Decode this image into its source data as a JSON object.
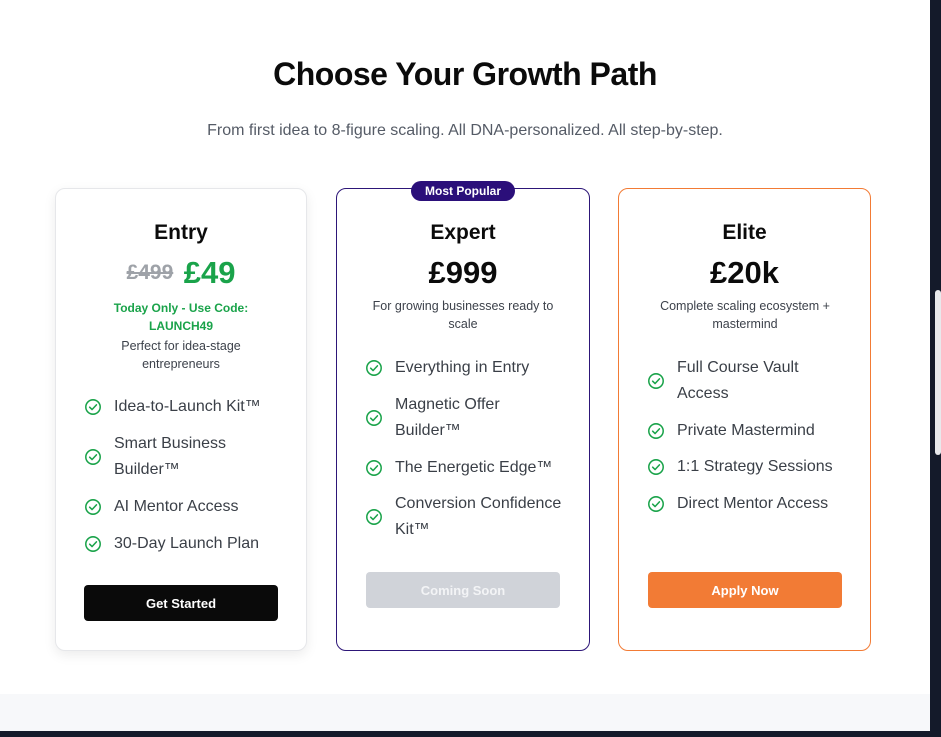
{
  "section": {
    "title": "Choose Your Growth Path",
    "subtitle": "From first idea to 8-figure scaling. All DNA-personalized. All step-by-step."
  },
  "plans": [
    {
      "name": "Entry",
      "old_price": "£499",
      "price": "£49",
      "promo": "Today Only - Use Code: LAUNCH49",
      "description": "Perfect for idea-stage entrepreneurs",
      "features": [
        "Idea-to-Launch Kit™",
        "Smart Business Builder™",
        "AI Mentor Access",
        "30-Day Launch Plan"
      ],
      "button_label": "Get Started"
    },
    {
      "name": "Expert",
      "badge": "Most Popular",
      "price": "£999",
      "description": "For growing businesses ready to scale",
      "features": [
        "Everything in Entry",
        "Magnetic Offer Builder™",
        "The Energetic Edge™",
        "Conversion Confidence Kit™"
      ],
      "button_label": "Coming Soon"
    },
    {
      "name": "Elite",
      "price": "£20k",
      "description": "Complete scaling ecosystem + mastermind",
      "features": [
        "Full Course Vault Access",
        "Private Mastermind",
        "1:1 Strategy Sessions",
        "Direct Mentor Access"
      ],
      "button_label": "Apply Now"
    }
  ],
  "icons": {
    "feature": "check-circle-icon"
  },
  "colors": {
    "accent_green": "#1aa34a",
    "expert_border": "#2d1678",
    "badge_bg": "#2b0f7a",
    "elite_orange": "#f27b35",
    "dark_button": "#0a0a0a",
    "disabled_button": "#d0d3d9"
  }
}
